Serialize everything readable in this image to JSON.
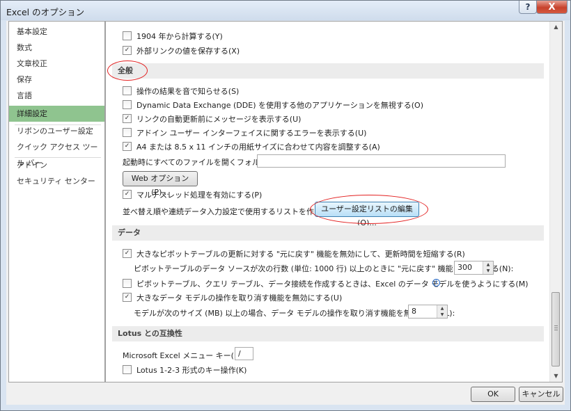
{
  "window": {
    "title": "Excel のオプション",
    "help_glyph": "?",
    "close_glyph": "X"
  },
  "nav": [
    "基本設定",
    "数式",
    "文章校正",
    "保存",
    "言語",
    "詳細設定",
    "リボンのユーザー設定",
    "クイック アクセス ツール バー",
    "アドイン",
    "セキュリティ センター"
  ],
  "nav_selected": "詳細設定",
  "top_options": [
    {
      "label": "1904 年から計算する(Y)",
      "checked": false
    },
    {
      "label": "外部リンクの値を保存する(X)",
      "checked": true
    }
  ],
  "general": {
    "header": "全般",
    "options": [
      {
        "label": "操作の結果を音で知らせる(S)",
        "checked": false
      },
      {
        "label": "Dynamic Data Exchange (DDE) を使用する他のアプリケーションを無視する(O)",
        "checked": false
      },
      {
        "label": "リンクの自動更新前にメッセージを表示する(U)",
        "checked": true
      },
      {
        "label": "アドイン ユーザー インターフェイスに関するエラーを表示する(U)",
        "checked": false
      },
      {
        "label": "A4 または 8.5 x 11 インチの用紙サイズに合わせて内容を調整する(A)",
        "checked": true
      }
    ],
    "startup_folder_label": "起動時にすべてのファイルを開くフォルダー(L):",
    "startup_folder_value": "",
    "web_options_button": "Web オプション(P)...",
    "multithread_label": "マルチスレッド処理を有効にする(P)",
    "multithread_checked": true,
    "custom_list_label": "並べ替え順や連続データ入力設定で使用するリストを作成します:",
    "custom_list_button": "ユーザー設定リストの編集(O)..."
  },
  "data": {
    "header": "データ",
    "pivot_undo_label": "大きなピボットテーブルの更新に対する \"元に戻す\" 機能を無効にして、更新時間を短縮する(R)",
    "pivot_undo_checked": true,
    "pivot_rows_label": "ピボットテーブルのデータ ソースが次の行数 (単位: 1000 行) 以上のときに \"元に戻す\" 機能を無効にする(N):",
    "pivot_rows_value": "300",
    "data_model_label": "ピボットテーブル、クエリ テーブル、データ接続を作成するときは、Excel のデータ モデルを使うようにする(M)",
    "data_model_checked": false,
    "info_glyph": "i",
    "model_undo_label": "大きなデータ モデルの操作を取り消す機能を無効にする(U)",
    "model_undo_checked": true,
    "model_size_label": "モデルが次のサイズ (MB) 以上の場合、データ モデルの操作を取り消す機能を無効にする(L):",
    "model_size_value": "8"
  },
  "lotus": {
    "header": "Lotus との互換性",
    "menu_key_label": "Microsoft Excel メニュー キー(M):",
    "menu_key_value": "/",
    "lotus_keys_label": "Lotus 1-2-3 形式のキー操作(K)",
    "lotus_keys_checked": false
  },
  "buttons": {
    "ok": "OK",
    "cancel": "キャンセル"
  },
  "icons": {
    "check": "✓",
    "up": "▲",
    "down": "▼",
    "grip": "≡"
  },
  "annotation_color": "#e32020"
}
